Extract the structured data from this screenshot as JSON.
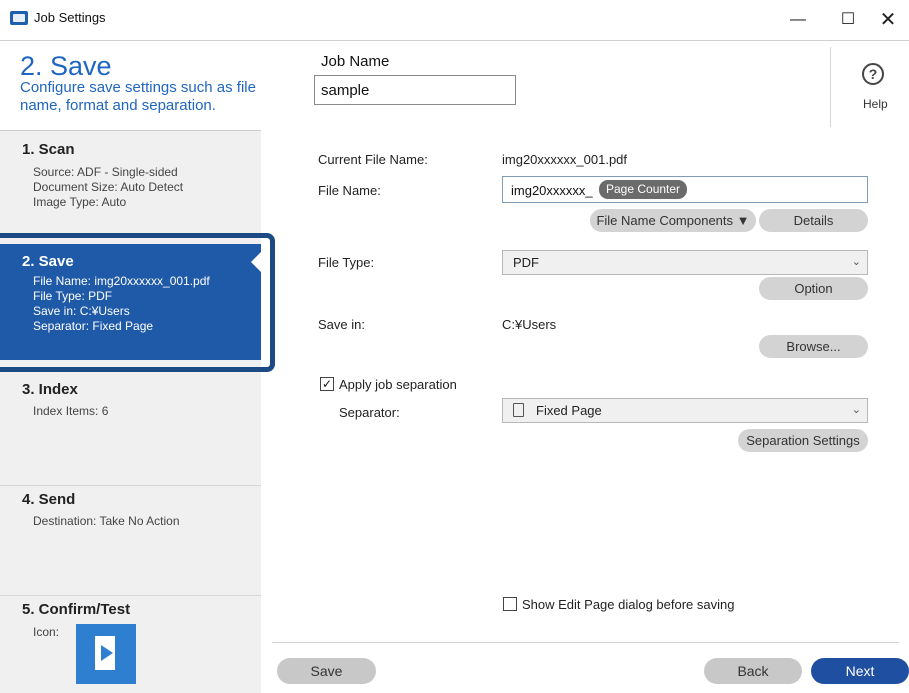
{
  "window": {
    "title": "Job Settings",
    "min": "—",
    "max": "☐",
    "close": "✕"
  },
  "header": {
    "step_title": "2. Save",
    "step_desc": "Configure save settings such as file name, format and separation.",
    "job_name_label": "Job Name",
    "job_name_value": "sample",
    "help_glyph": "?",
    "help_label": "Help"
  },
  "sidebar": {
    "steps": [
      {
        "title": "1. Scan",
        "lines": [
          "Source: ADF - Single-sided",
          "Document Size: Auto Detect",
          "Image Type: Auto"
        ]
      },
      {
        "title": "2. Save",
        "lines": [
          "File Name: img20xxxxxx_001.pdf",
          "File Type: PDF",
          "Save in: C:¥Users",
          "Separator: Fixed Page"
        ]
      },
      {
        "title": "3. Index",
        "lines": [
          "Index Items: 6"
        ]
      },
      {
        "title": "4. Send",
        "lines": [
          "Destination: Take No Action"
        ]
      },
      {
        "title": "5. Confirm/Test",
        "lines": [
          "Icon:"
        ]
      }
    ]
  },
  "form": {
    "current_file_name_label": "Current File Name:",
    "current_file_name_value": "img20xxxxxx_001.pdf",
    "file_name_label": "File Name:",
    "file_name_prefix": "img20xxxxxx_",
    "file_name_chip": "Page Counter",
    "file_name_components_button": "File Name Components ▼",
    "details_button": "Details",
    "file_type_label": "File Type:",
    "file_type_value": "PDF",
    "option_button": "Option",
    "save_in_label": "Save in:",
    "save_in_value": "C:¥Users",
    "browse_button": "Browse...",
    "apply_separation_label": "Apply job separation",
    "apply_separation_checked": "✓",
    "separator_label": "Separator:",
    "separator_value": "Fixed Page",
    "separation_settings_button": "Separation Settings",
    "show_edit_page_label": "Show Edit Page dialog before saving",
    "show_edit_page_checked": ""
  },
  "footer": {
    "save": "Save",
    "back": "Back",
    "next": "Next"
  },
  "colors": {
    "accent": "#1f66c1",
    "active_step_bg": "#1f5aa8",
    "next_button": "#1f4fa0"
  }
}
